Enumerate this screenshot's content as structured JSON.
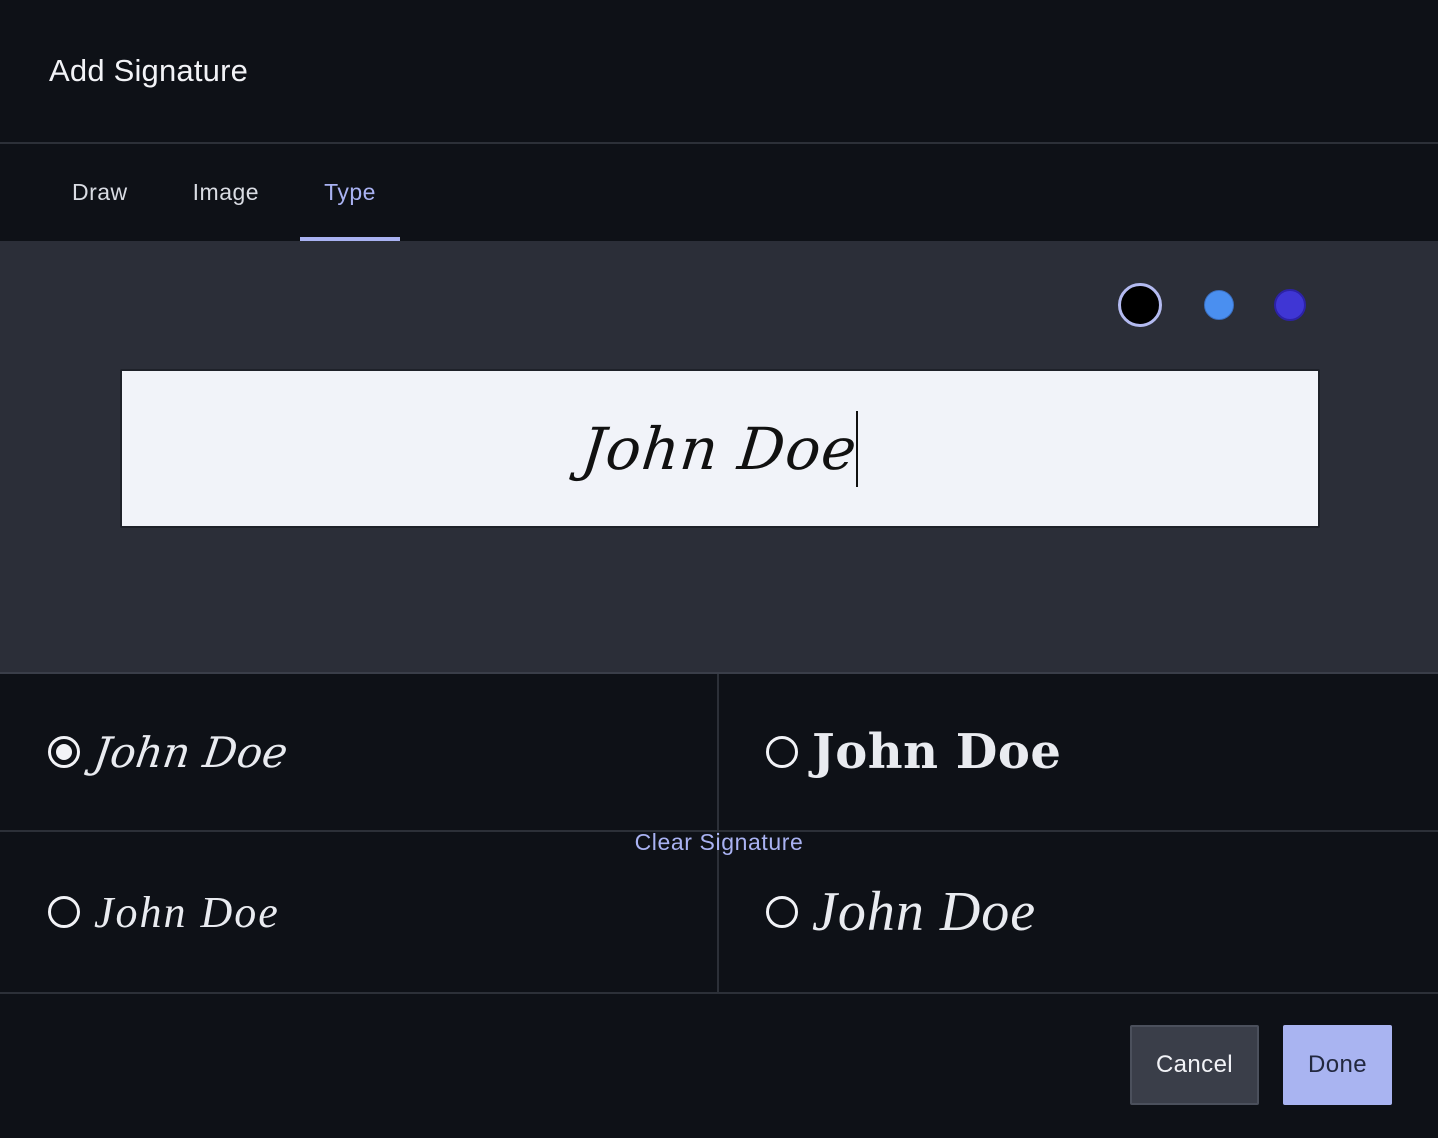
{
  "dialog": {
    "title": "Add Signature"
  },
  "tabs": [
    {
      "label": "Draw",
      "active": false
    },
    {
      "label": "Image",
      "active": false
    },
    {
      "label": "Type",
      "active": true
    }
  ],
  "colors": {
    "accent": "#a9b2f2",
    "swatches": [
      {
        "name": "black",
        "hex": "#000000",
        "selected": true
      },
      {
        "name": "blue",
        "hex": "#4a8ff0",
        "selected": false
      },
      {
        "name": "indigo",
        "hex": "#3f36d4",
        "selected": false
      }
    ]
  },
  "signature_input": {
    "value": "John Doe"
  },
  "clear_label": "Clear Signature",
  "style_options": [
    {
      "text": "John Doe",
      "selected": true
    },
    {
      "text": "John Doe",
      "selected": false
    },
    {
      "text": "John Doe",
      "selected": false
    },
    {
      "text": "John Doe",
      "selected": false
    }
  ],
  "footer": {
    "cancel_label": "Cancel",
    "done_label": "Done"
  }
}
